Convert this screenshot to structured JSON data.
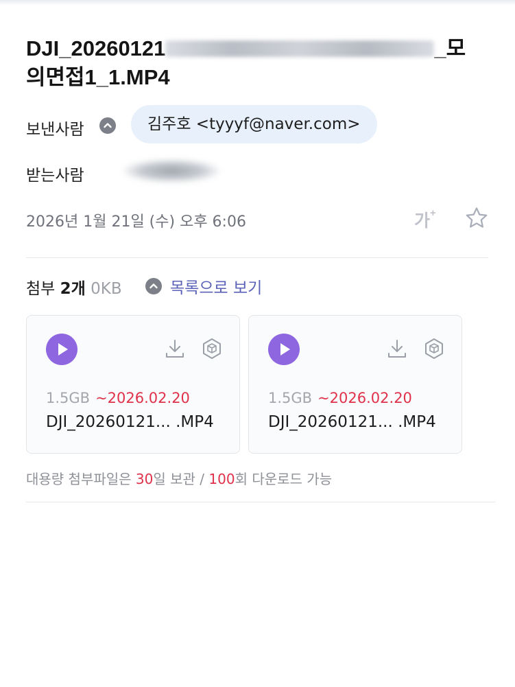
{
  "email": {
    "title_start": "DJI_20260121",
    "title_end": "_모",
    "title_line2": "의면접1_1.MP4",
    "sender_label": "보낸사람",
    "sender": "김주호 <tyyyf@naver.com>",
    "recipient_label": "받는사람",
    "date": "2026년 1월 21일 (수) 오후 6:06",
    "font_size_label": "가",
    "font_size_plus": "+"
  },
  "attachments": {
    "label": "첨부",
    "count": "2개",
    "total_size": "0KB",
    "list_link": "목록으로 보기",
    "files": [
      {
        "size": "1.5GB",
        "expiry": "~2026.02.20",
        "name": "DJI_20260121... .MP4"
      },
      {
        "size": "1.5GB",
        "expiry": "~2026.02.20",
        "name": "DJI_20260121... .MP4"
      }
    ],
    "notice_prefix": "대용량 첨부파일은 ",
    "notice_days": "30",
    "notice_middle": "일 보관 / ",
    "notice_count": "100",
    "notice_suffix": "회 다운로드 가능"
  },
  "colors": {
    "accent_purple": "#8e67e0",
    "link_blue": "#5b63b8",
    "expiry_red": "#e0314a",
    "chip_bg": "#e7f0fb"
  },
  "icons": [
    "chevron-up-icon",
    "star-icon",
    "font-size-icon",
    "play-icon",
    "download-icon",
    "box-icon"
  ]
}
